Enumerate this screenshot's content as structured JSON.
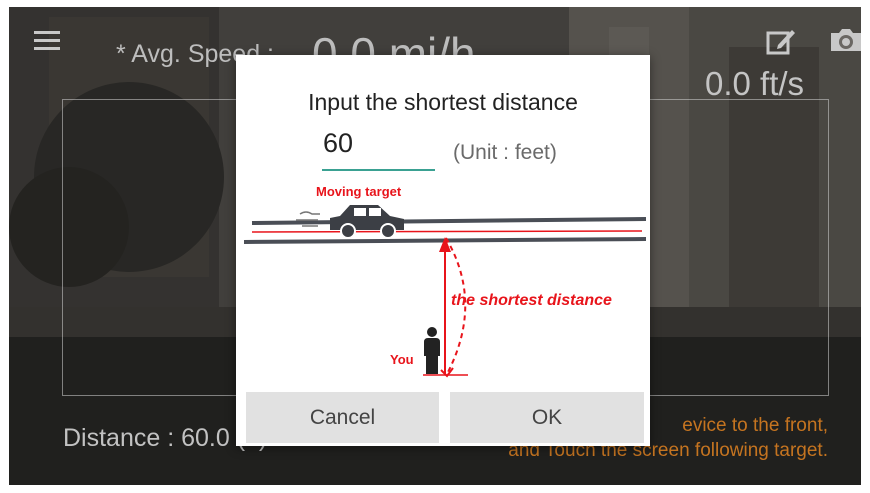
{
  "hud": {
    "avg_speed_label": "* Avg. Speed :",
    "avg_speed_value": "0.0 mi/h",
    "speed_fts": "0.0 ft/s",
    "distance_label": "Distance : 60.0",
    "distance_suffix": "(ft)",
    "hint_line1": "evice to the front,",
    "hint_line2": "and Touch the screen following target.",
    "hint_color": "#c57420"
  },
  "icons": [
    "menu-icon",
    "edit-icon",
    "camera-icon"
  ],
  "dialog": {
    "title": "Input the shortest distance",
    "input_value": "60",
    "unit_label": "(Unit : feet)",
    "diagram": {
      "moving_target_label": "Moving target",
      "distance_label": "the shortest distance",
      "you_label": "You",
      "accent_color": "#e8141b"
    },
    "cancel_label": "Cancel",
    "ok_label": "OK",
    "input_accent": "#3aa192"
  }
}
